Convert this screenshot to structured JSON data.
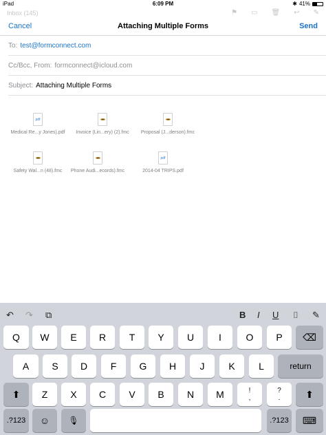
{
  "status": {
    "device": "iPad",
    "time": "6:09 PM",
    "battery": "41%"
  },
  "ghost": {
    "inbox": "Inbox (145)"
  },
  "header": {
    "cancel": "Cancel",
    "title": "Attaching Multiple Forms",
    "send": "Send"
  },
  "fields": {
    "to_label": "To:",
    "to_value": "test@formconnect.com",
    "cc_label": "Cc/Bcc, From:",
    "cc_value": "formconnect@icloud.com",
    "subject_label": "Subject:",
    "subject_value": "Attaching Multiple Forms"
  },
  "attachments": [
    {
      "name": "Medical Re...y Jones).pdf",
      "kind": "pdf",
      "icon_label": "pdf"
    },
    {
      "name": "Invoice (Lin...ery) (2).fmc",
      "kind": "fmc"
    },
    {
      "name": "Proposal (J...derson).fmc",
      "kind": "fmc"
    },
    {
      "name": "Safety Wal...n (48).fmc",
      "kind": "fmc"
    },
    {
      "name": "Phone Audi...ecords).fmc",
      "kind": "fmc"
    },
    {
      "name": "2014-04 TRIPS.pdf",
      "kind": "pdf",
      "icon_label": "pdf"
    }
  ],
  "keyboard": {
    "tools": {
      "undo": "↶",
      "redo": "↷",
      "paste": "⧉",
      "bold": "B",
      "italic": "I",
      "underline": "U",
      "camera": "⌷",
      "attach": "✎"
    },
    "row1": [
      "Q",
      "W",
      "E",
      "R",
      "T",
      "Y",
      "U",
      "I",
      "O",
      "P"
    ],
    "backspace": "⌫",
    "row2": [
      "A",
      "S",
      "D",
      "F",
      "G",
      "H",
      "J",
      "K",
      "L"
    ],
    "return": "return",
    "shift": "⬆",
    "row3": [
      "Z",
      "X",
      "C",
      "V",
      "B",
      "N",
      "M"
    ],
    "punct1_top": "!",
    "punct1_bottom": ",",
    "punct2_top": "?",
    "punct2_bottom": ".",
    "numbers": ".?123",
    "emoji": "☺",
    "mic": "🎙",
    "hide": "⌨"
  }
}
